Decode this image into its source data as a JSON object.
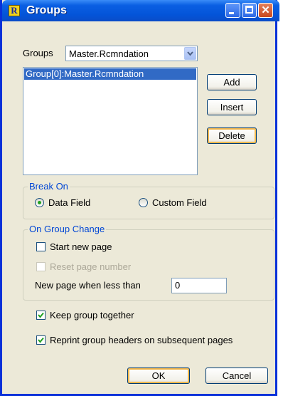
{
  "window": {
    "title": "Groups",
    "app_icon_letter": "R"
  },
  "groups_label": "Groups",
  "groups_combo": {
    "selected": "Master.Rcmndation"
  },
  "groups_list": [
    "Group[0]:Master.Rcmndation"
  ],
  "buttons": {
    "add": "Add",
    "insert": "Insert",
    "delete": "Delete",
    "ok": "OK",
    "cancel": "Cancel"
  },
  "break_on": {
    "title": "Break On",
    "data_field": "Data Field",
    "custom_field": "Custom Field",
    "selected": "data_field"
  },
  "on_group_change": {
    "title": "On Group Change",
    "start_new_page": "Start new page",
    "reset_page_number": "Reset page number",
    "new_page_when_less_than": "New page when less than",
    "new_page_value": "0"
  },
  "keep_group_together": "Keep group together",
  "reprint_headers": "Reprint group headers on subsequent pages",
  "colors": {
    "title_bar": "#0a5fe3",
    "dialog_bg": "#ece9d8",
    "selection": "#316ac5",
    "group_title": "#0046d5"
  }
}
